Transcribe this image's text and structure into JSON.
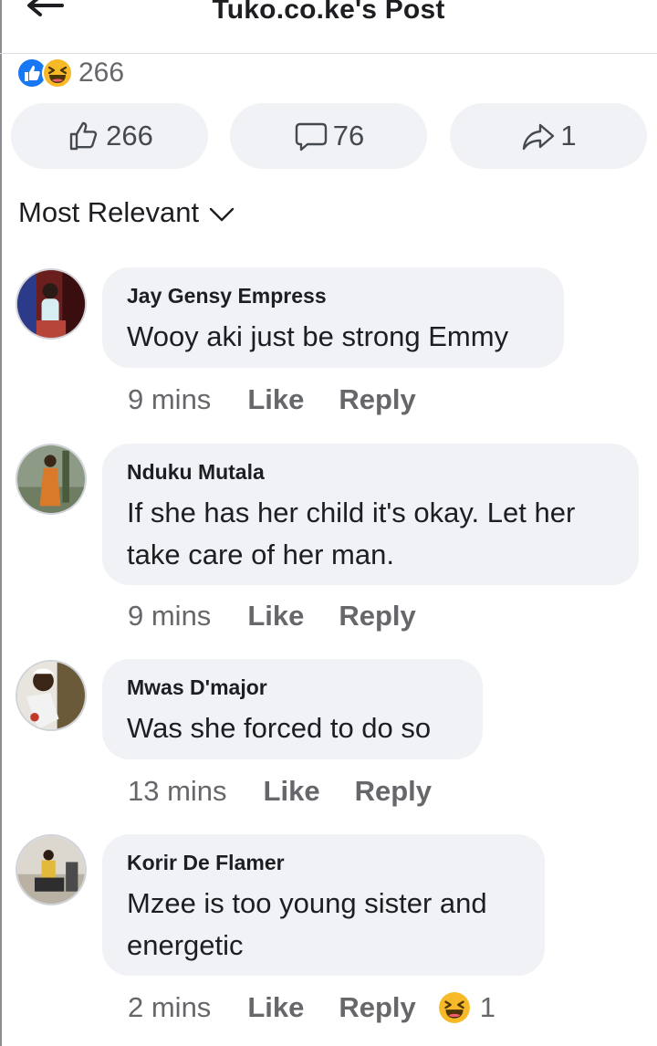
{
  "header": {
    "title": "Tuko.co.ke's Post"
  },
  "reactions": {
    "count": "266",
    "icons": [
      "like-icon",
      "haha-icon"
    ]
  },
  "actions": {
    "like_count": "266",
    "comment_count": "76",
    "share_count": "1"
  },
  "sort": {
    "label": "Most Relevant"
  },
  "comments": [
    {
      "author": "Jay Gensy Empress",
      "text": "Wooy aki just be strong Emmy",
      "time": "9 mins",
      "like": "Like",
      "reply": "Reply"
    },
    {
      "author": "Nduku Mutala",
      "text": "If she has her child it's okay. Let her take care of her man.",
      "time": "9 mins",
      "like": "Like",
      "reply": "Reply"
    },
    {
      "author": "Mwas D'major",
      "text": "Was she forced to do so",
      "time": "13 mins",
      "like": "Like",
      "reply": "Reply"
    },
    {
      "author": "Korir De Flamer",
      "text": "Mzee is too young sister and energetic",
      "time": "2 mins",
      "like": "Like",
      "reply": "Reply",
      "reaction_icon": "haha-icon",
      "reaction_count": "1"
    }
  ],
  "colors": {
    "like_blue": "#1877f2",
    "haha_yellow": "#f7b928",
    "pill_bg": "#f0f2f5",
    "muted_text": "#65676b"
  }
}
